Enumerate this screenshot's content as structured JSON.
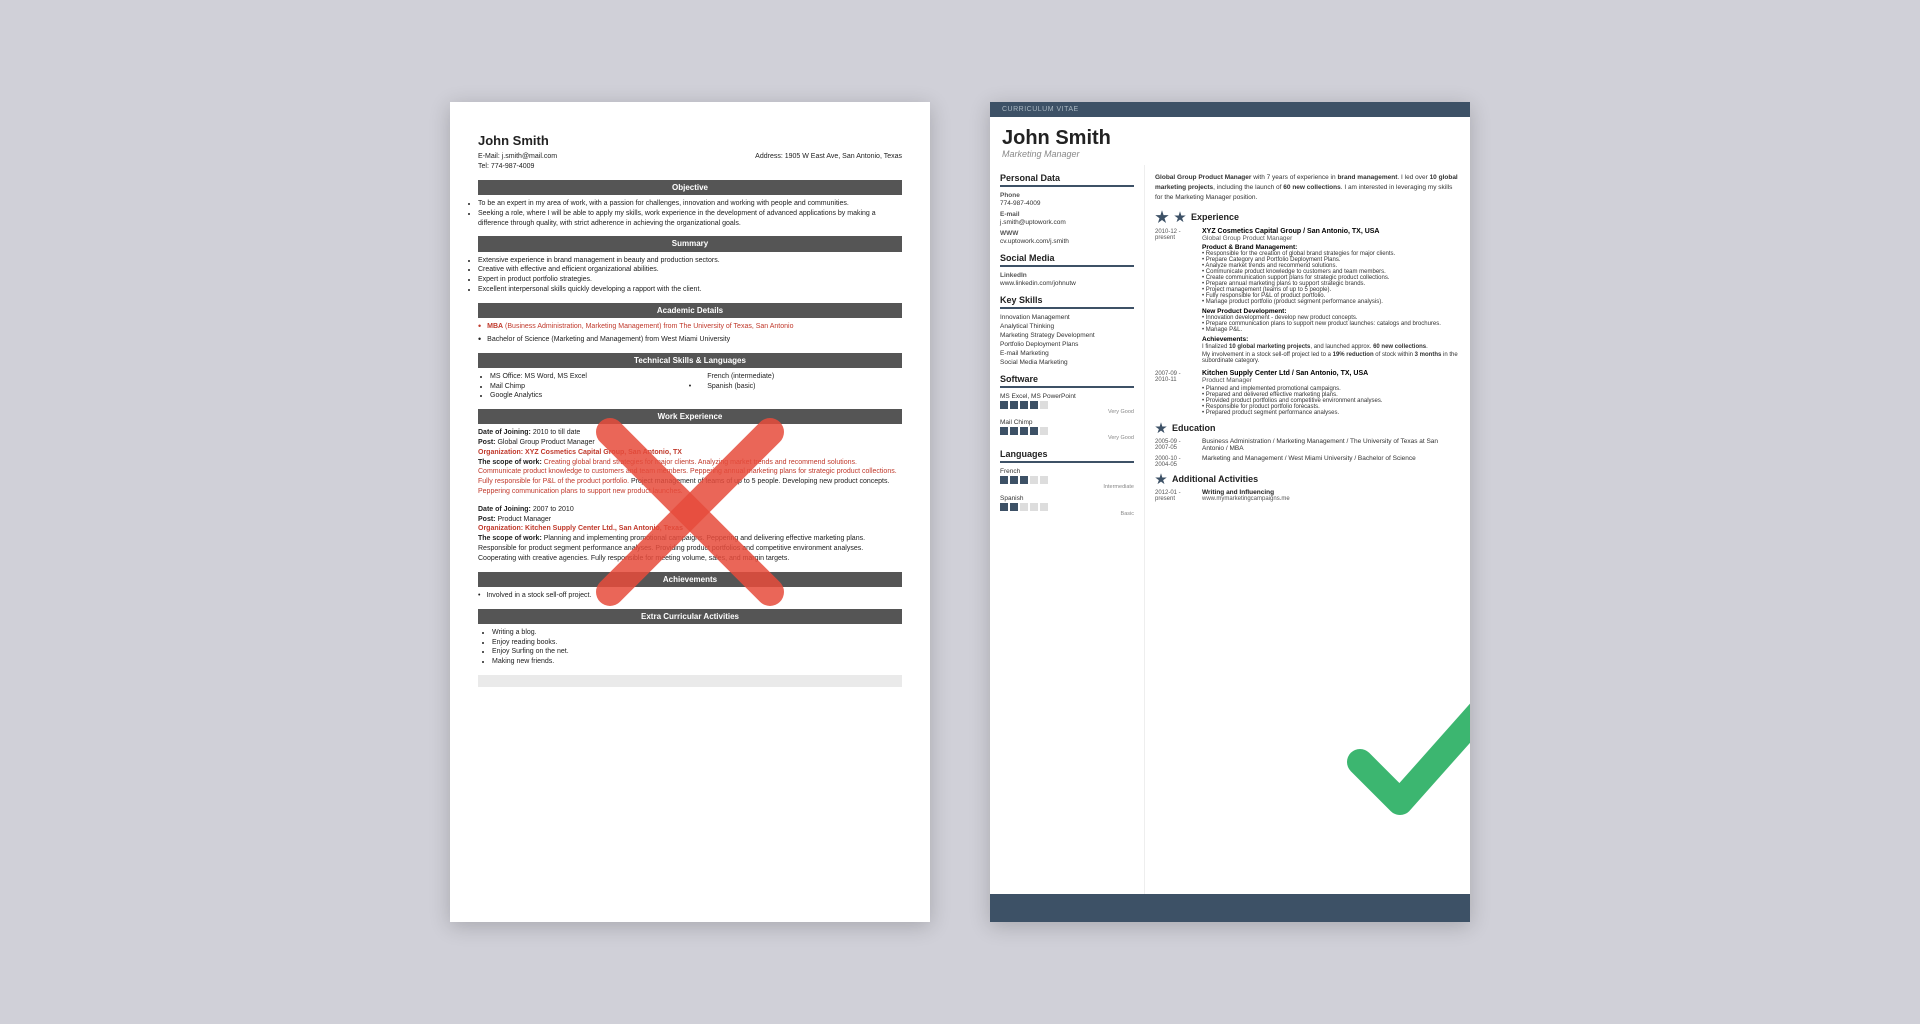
{
  "left_resume": {
    "name": "John Smith",
    "email": "E-Mail: j.smith@mail.com",
    "phone": "Tel: 774-987-4009",
    "address": "Address: 1905 W East Ave, San Antonio, Texas",
    "sections": {
      "objective": {
        "title": "Objective",
        "bullets": [
          "To be an expert in my area of work, with a passion for challenges, innovation and working with people and communities.",
          "Seeking a role, where I will be able to apply my skills, work experience in the development of advanced applications by making a difference through quality, with strict adherence in achieving the organizational goals."
        ]
      },
      "summary": {
        "title": "Summary",
        "bullets": [
          "Extensive experience in brand management in beauty and production sectors.",
          "Creative with effective and efficient organizational abilities.",
          "Expert in product portfolio strategies.",
          "Excellent interpersonal skills quickly developing a rapport with the client."
        ]
      },
      "academic": {
        "title": "Academic Details",
        "items": [
          "MBA (Business Administration, Marketing Management) from The University of Texas, San Antonio",
          "Bachelor of Science (Marketing and Management) from West Miami University"
        ]
      },
      "technical": {
        "title": "Technical Skills & Languages",
        "left_skills": [
          "MS Office: MS Word, MS Excel",
          "Mail Chimp",
          "Google Analytics"
        ],
        "right_skills": [
          "French (intermediate)",
          "Spanish (basic)"
        ]
      },
      "work": {
        "title": "Work Experience",
        "entries": [
          {
            "date_joining": "Date of Joining: 2010 to till date",
            "post": "Post: Global Group Product Manager",
            "org": "Organization: XYZ Cosmetics Capital Group, San Antonio, TX",
            "scope_label": "The scope of work:",
            "scope": "Creating global brand strategies for major clients. Analyzing market trends and recommend solutions. Communicate product knowledge to customers and team members. Peppering annual marketing plans for strategic product collections. Fully responsible for P&L of the product portfolio. Project management of teams of up to 5 people. Developing new product concepts. Peppering communication plans to support new product launches."
          },
          {
            "date_joining": "Date of Joining: 2007 to 2010",
            "post": "Post: Product Manager",
            "org": "Organization: Kitchen Supply Center Ltd., San Antonio, Texas",
            "scope_label": "The scope of work:",
            "scope": "Planning and implementing promotional campaigns. Peppering and delivering effective marketing plans. Responsible for product segment performance analyses. Providing product portfolios and competitive environment analyses. Cooperating with creative agencies. Fully responsible for meeting volume, sales, and margin targets."
          }
        ]
      },
      "achievements": {
        "title": "Achievements",
        "items": [
          "Involved in a stock sell-off project."
        ]
      },
      "extra": {
        "title": "Extra Curricular Activities",
        "items": [
          "Writing a blog.",
          "Enjoy reading books.",
          "Enjoy Surfing on the net.",
          "Making new friends."
        ]
      }
    }
  },
  "right_resume": {
    "cv_label": "Curriculum Vitae",
    "name": "John Smith",
    "title": "Marketing Manager",
    "intro": "Global Group Product Manager with 7 years of experience in brand management. I led over 10 global marketing projects, including the launch of 60 new collections. I am interested in leveraging my skills for the Marketing Manager position.",
    "personal_data": {
      "title": "Personal Data",
      "phone_label": "Phone",
      "phone": "774-987-4009",
      "email_label": "E-mail",
      "email": "j.smith@uptowork.com",
      "www_label": "WWW",
      "www": "cv.uptowork.com/j.smith"
    },
    "social_media": {
      "title": "Social Media",
      "linkedin_label": "LinkedIn",
      "linkedin": "www.linkedin.com/johnutw"
    },
    "key_skills": {
      "title": "Key Skills",
      "items": [
        "Innovation Management",
        "Analytical Thinking",
        "Marketing Strategy Development",
        "Portfolio Deployment Plans",
        "E-mail Marketing",
        "Social Media Marketing"
      ]
    },
    "software": {
      "title": "Software",
      "items": [
        {
          "name": "MS Excel, MS PowerPoint",
          "filled": 4,
          "total": 5,
          "level": "Very Good"
        },
        {
          "name": "Mail Chimp",
          "filled": 4,
          "total": 5,
          "level": "Very Good"
        }
      ]
    },
    "languages": {
      "title": "Languages",
      "items": [
        {
          "name": "French",
          "filled": 3,
          "total": 5,
          "level": "Intermediate"
        },
        {
          "name": "Spanish",
          "filled": 2,
          "total": 5,
          "level": "Basic"
        }
      ]
    },
    "experience": {
      "title": "Experience",
      "entries": [
        {
          "date": "2010-12 - present",
          "company": "XYZ Cosmetics Capital Group / San Antonio, TX, USA",
          "role": "Global Group Product Manager",
          "sub_sections": [
            {
              "title": "Product & Brand Management:",
              "bullets": [
                "Responsible for the creation of global brand strategies for major clients.",
                "Prepare Category and Portfolio Deployment Plans.",
                "Analyze market trends and recommend solutions.",
                "Communicate product knowledge to customers and team members.",
                "Create communication support plans for strategic product collections.",
                "Prepare annual marketing plans to support strategic brands.",
                "Project management (teams of up to 5 people).",
                "Fully responsible for P&L of product portfolio.",
                "Manage product portfolio (product segment performance analysis)."
              ]
            },
            {
              "title": "New Product Development:",
              "bullets": [
                "Innovation development - develop new product concepts.",
                "Prepare communication plans to support new product launches: catalogs and brochures.",
                "Manage P&L."
              ]
            }
          ],
          "achievement_label": "Achievements:",
          "achievement_text": "I finalized 10 global marketing projects, and launched approx. 60 new collections.",
          "achievement_text2": "My involvement in a stock sell-off project led to a 19% reduction of stock within 3 months in the subordinate category."
        },
        {
          "date": "2007-09 - 2010-11",
          "company": "Kitchen Supply Center Ltd / San Antonio, TX, USA",
          "role": "Product Manager",
          "bullets": [
            "Planned and implemented promotional campaigns.",
            "Prepared and delivered effective marketing plans.",
            "Provided product portfolios and competitive environment analyses.",
            "Responsible for product portfolio forecasts.",
            "Prepared product segment performance analyses."
          ]
        }
      ]
    },
    "education": {
      "title": "Education",
      "entries": [
        {
          "date": "2005-09 - 2007-05",
          "degree": "Business Administration / Marketing Management / The University of Texas at San Antonio / MBA"
        },
        {
          "date": "2000-10 - 2004-05",
          "degree": "Marketing and Management / West Miami University / Bachelor of Science"
        }
      ]
    },
    "additional": {
      "title": "Additional Activities",
      "entries": [
        {
          "date": "2012-01 - present",
          "title": "Writing and Influencing",
          "detail": "www.mymarketingcampaigns.me"
        }
      ]
    }
  }
}
